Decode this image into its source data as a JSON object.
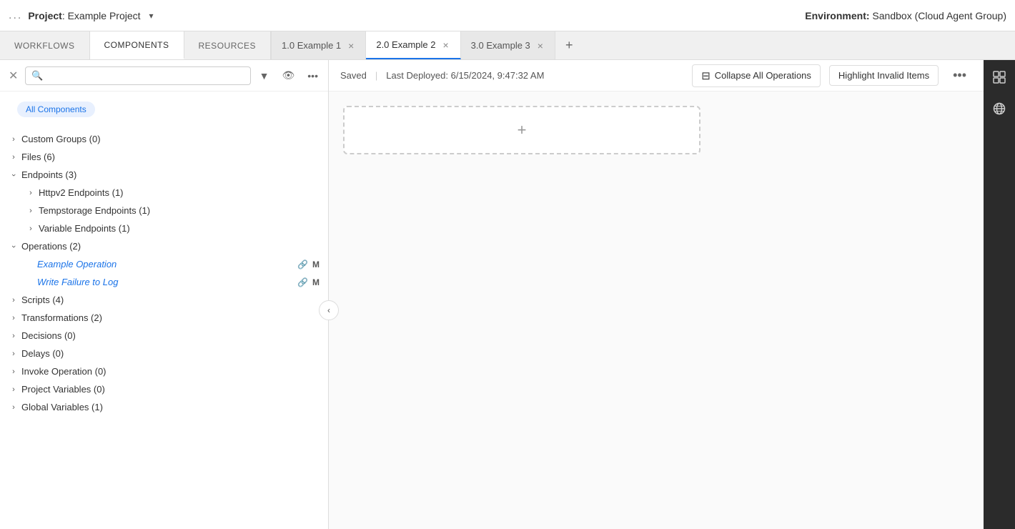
{
  "titleBar": {
    "dots": "...",
    "projectLabel": "Project",
    "projectName": "Example Project",
    "dropdownChar": "▾",
    "envLabel": "Environment:",
    "envName": "Sandbox (Cloud Agent Group)"
  },
  "tabs": {
    "nav": [
      {
        "id": "workflows",
        "label": "WORKFLOWS",
        "active": false
      },
      {
        "id": "components",
        "label": "COMPONENTS",
        "active": true
      },
      {
        "id": "resources",
        "label": "RESOURCES",
        "active": false
      }
    ],
    "docs": [
      {
        "id": "doc1",
        "version": "1.0",
        "name": "Example 1",
        "active": false,
        "closable": true
      },
      {
        "id": "doc2",
        "version": "2.0",
        "name": "Example 2",
        "active": true,
        "closable": true
      },
      {
        "id": "doc3",
        "version": "3.0",
        "name": "Example 3",
        "active": false,
        "closable": true
      }
    ],
    "addTab": "+"
  },
  "sidebar": {
    "filterTag": "All Components",
    "searchPlaceholder": "",
    "tree": [
      {
        "label": "Custom Groups (0)",
        "level": 0,
        "expanded": false,
        "chevron": "›"
      },
      {
        "label": "Files (6)",
        "level": 0,
        "expanded": false,
        "chevron": "›"
      },
      {
        "label": "Endpoints (3)",
        "level": 0,
        "expanded": true,
        "chevron": "⌄"
      },
      {
        "label": "Httpv2 Endpoints (1)",
        "level": 1,
        "expanded": false,
        "chevron": "›"
      },
      {
        "label": "Tempstorage Endpoints (1)",
        "level": 1,
        "expanded": false,
        "chevron": "›"
      },
      {
        "label": "Variable Endpoints (1)",
        "level": 1,
        "expanded": false,
        "chevron": "›"
      },
      {
        "label": "Operations (2)",
        "level": 0,
        "expanded": true,
        "chevron": "⌄"
      },
      {
        "label": "Scripts (4)",
        "level": 0,
        "expanded": false,
        "chevron": "›"
      },
      {
        "label": "Transformations (2)",
        "level": 0,
        "expanded": false,
        "chevron": "›"
      },
      {
        "label": "Decisions (0)",
        "level": 0,
        "expanded": false,
        "chevron": "›"
      },
      {
        "label": "Delays (0)",
        "level": 0,
        "expanded": false,
        "chevron": "›"
      },
      {
        "label": "Invoke Operation (0)",
        "level": 0,
        "expanded": false,
        "chevron": "›"
      },
      {
        "label": "Project Variables (0)",
        "level": 0,
        "expanded": false,
        "chevron": "›"
      },
      {
        "label": "Global Variables (1)",
        "level": 0,
        "expanded": false,
        "chevron": "›"
      }
    ],
    "operations": [
      {
        "label": "Example Operation",
        "linkIcon": "🔗",
        "badge": "M"
      },
      {
        "label": "Write Failure to Log",
        "linkIcon": "🔗",
        "badge": "M"
      }
    ]
  },
  "workspace": {
    "savedStatus": "Saved",
    "separator": "|",
    "lastDeployed": "Last Deployed: 6/15/2024, 9:47:32 AM",
    "collapseBtn": "Collapse All Operations",
    "highlightBtn": "Highlight Invalid Items",
    "moreBtn": "•••",
    "addIcon": "+"
  },
  "rightPanel": {
    "icons": [
      {
        "name": "grid-icon",
        "symbol": "⊞"
      },
      {
        "name": "globe-icon",
        "symbol": "🌐"
      }
    ]
  }
}
